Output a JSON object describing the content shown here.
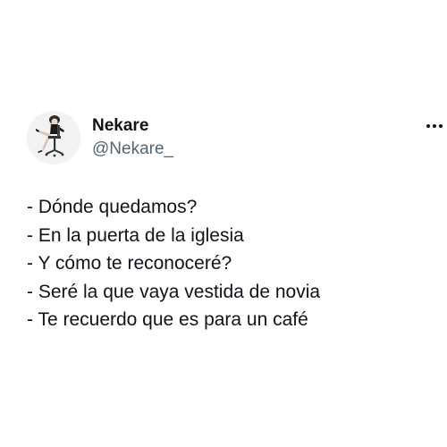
{
  "tweet": {
    "author": {
      "display_name": "Nekare",
      "handle": "@Nekare_",
      "avatar_icon": "avatar-figure-on-chair-icon"
    },
    "more_icon": "more-options-icon",
    "lines": [
      "- Dónde quedamos?",
      "- En la puerta de la iglesia",
      "- Y cómo te reconoceré?",
      "- Seré la que vaya vestida de novia",
      "- Te recuerdo que es para un café"
    ]
  },
  "colors": {
    "background": "#ffffff",
    "text": "#0f1419",
    "secondary_text": "#536471"
  }
}
